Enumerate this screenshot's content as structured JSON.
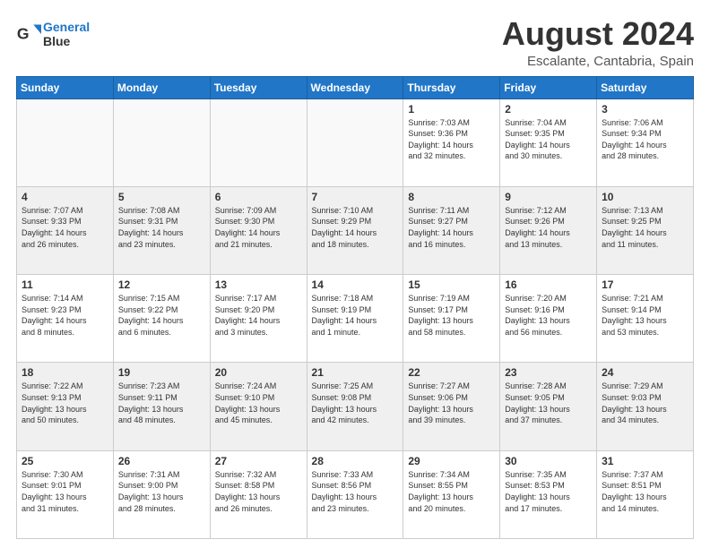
{
  "header": {
    "logo_line1": "General",
    "logo_line2": "Blue",
    "title": "August 2024",
    "subtitle": "Escalante, Cantabria, Spain"
  },
  "calendar": {
    "days": [
      "Sunday",
      "Monday",
      "Tuesday",
      "Wednesday",
      "Thursday",
      "Friday",
      "Saturday"
    ],
    "weeks": [
      {
        "cells": [
          {
            "day": "",
            "content": ""
          },
          {
            "day": "",
            "content": ""
          },
          {
            "day": "",
            "content": ""
          },
          {
            "day": "",
            "content": ""
          },
          {
            "day": "1",
            "content": "Sunrise: 7:03 AM\nSunset: 9:36 PM\nDaylight: 14 hours\nand 32 minutes."
          },
          {
            "day": "2",
            "content": "Sunrise: 7:04 AM\nSunset: 9:35 PM\nDaylight: 14 hours\nand 30 minutes."
          },
          {
            "day": "3",
            "content": "Sunrise: 7:06 AM\nSunset: 9:34 PM\nDaylight: 14 hours\nand 28 minutes."
          }
        ]
      },
      {
        "cells": [
          {
            "day": "4",
            "content": "Sunrise: 7:07 AM\nSunset: 9:33 PM\nDaylight: 14 hours\nand 26 minutes."
          },
          {
            "day": "5",
            "content": "Sunrise: 7:08 AM\nSunset: 9:31 PM\nDaylight: 14 hours\nand 23 minutes."
          },
          {
            "day": "6",
            "content": "Sunrise: 7:09 AM\nSunset: 9:30 PM\nDaylight: 14 hours\nand 21 minutes."
          },
          {
            "day": "7",
            "content": "Sunrise: 7:10 AM\nSunset: 9:29 PM\nDaylight: 14 hours\nand 18 minutes."
          },
          {
            "day": "8",
            "content": "Sunrise: 7:11 AM\nSunset: 9:27 PM\nDaylight: 14 hours\nand 16 minutes."
          },
          {
            "day": "9",
            "content": "Sunrise: 7:12 AM\nSunset: 9:26 PM\nDaylight: 14 hours\nand 13 minutes."
          },
          {
            "day": "10",
            "content": "Sunrise: 7:13 AM\nSunset: 9:25 PM\nDaylight: 14 hours\nand 11 minutes."
          }
        ]
      },
      {
        "cells": [
          {
            "day": "11",
            "content": "Sunrise: 7:14 AM\nSunset: 9:23 PM\nDaylight: 14 hours\nand 8 minutes."
          },
          {
            "day": "12",
            "content": "Sunrise: 7:15 AM\nSunset: 9:22 PM\nDaylight: 14 hours\nand 6 minutes."
          },
          {
            "day": "13",
            "content": "Sunrise: 7:17 AM\nSunset: 9:20 PM\nDaylight: 14 hours\nand 3 minutes."
          },
          {
            "day": "14",
            "content": "Sunrise: 7:18 AM\nSunset: 9:19 PM\nDaylight: 14 hours\nand 1 minute."
          },
          {
            "day": "15",
            "content": "Sunrise: 7:19 AM\nSunset: 9:17 PM\nDaylight: 13 hours\nand 58 minutes."
          },
          {
            "day": "16",
            "content": "Sunrise: 7:20 AM\nSunset: 9:16 PM\nDaylight: 13 hours\nand 56 minutes."
          },
          {
            "day": "17",
            "content": "Sunrise: 7:21 AM\nSunset: 9:14 PM\nDaylight: 13 hours\nand 53 minutes."
          }
        ]
      },
      {
        "cells": [
          {
            "day": "18",
            "content": "Sunrise: 7:22 AM\nSunset: 9:13 PM\nDaylight: 13 hours\nand 50 minutes."
          },
          {
            "day": "19",
            "content": "Sunrise: 7:23 AM\nSunset: 9:11 PM\nDaylight: 13 hours\nand 48 minutes."
          },
          {
            "day": "20",
            "content": "Sunrise: 7:24 AM\nSunset: 9:10 PM\nDaylight: 13 hours\nand 45 minutes."
          },
          {
            "day": "21",
            "content": "Sunrise: 7:25 AM\nSunset: 9:08 PM\nDaylight: 13 hours\nand 42 minutes."
          },
          {
            "day": "22",
            "content": "Sunrise: 7:27 AM\nSunset: 9:06 PM\nDaylight: 13 hours\nand 39 minutes."
          },
          {
            "day": "23",
            "content": "Sunrise: 7:28 AM\nSunset: 9:05 PM\nDaylight: 13 hours\nand 37 minutes."
          },
          {
            "day": "24",
            "content": "Sunrise: 7:29 AM\nSunset: 9:03 PM\nDaylight: 13 hours\nand 34 minutes."
          }
        ]
      },
      {
        "cells": [
          {
            "day": "25",
            "content": "Sunrise: 7:30 AM\nSunset: 9:01 PM\nDaylight: 13 hours\nand 31 minutes."
          },
          {
            "day": "26",
            "content": "Sunrise: 7:31 AM\nSunset: 9:00 PM\nDaylight: 13 hours\nand 28 minutes."
          },
          {
            "day": "27",
            "content": "Sunrise: 7:32 AM\nSunset: 8:58 PM\nDaylight: 13 hours\nand 26 minutes."
          },
          {
            "day": "28",
            "content": "Sunrise: 7:33 AM\nSunset: 8:56 PM\nDaylight: 13 hours\nand 23 minutes."
          },
          {
            "day": "29",
            "content": "Sunrise: 7:34 AM\nSunset: 8:55 PM\nDaylight: 13 hours\nand 20 minutes."
          },
          {
            "day": "30",
            "content": "Sunrise: 7:35 AM\nSunset: 8:53 PM\nDaylight: 13 hours\nand 17 minutes."
          },
          {
            "day": "31",
            "content": "Sunrise: 7:37 AM\nSunset: 8:51 PM\nDaylight: 13 hours\nand 14 minutes."
          }
        ]
      }
    ]
  }
}
